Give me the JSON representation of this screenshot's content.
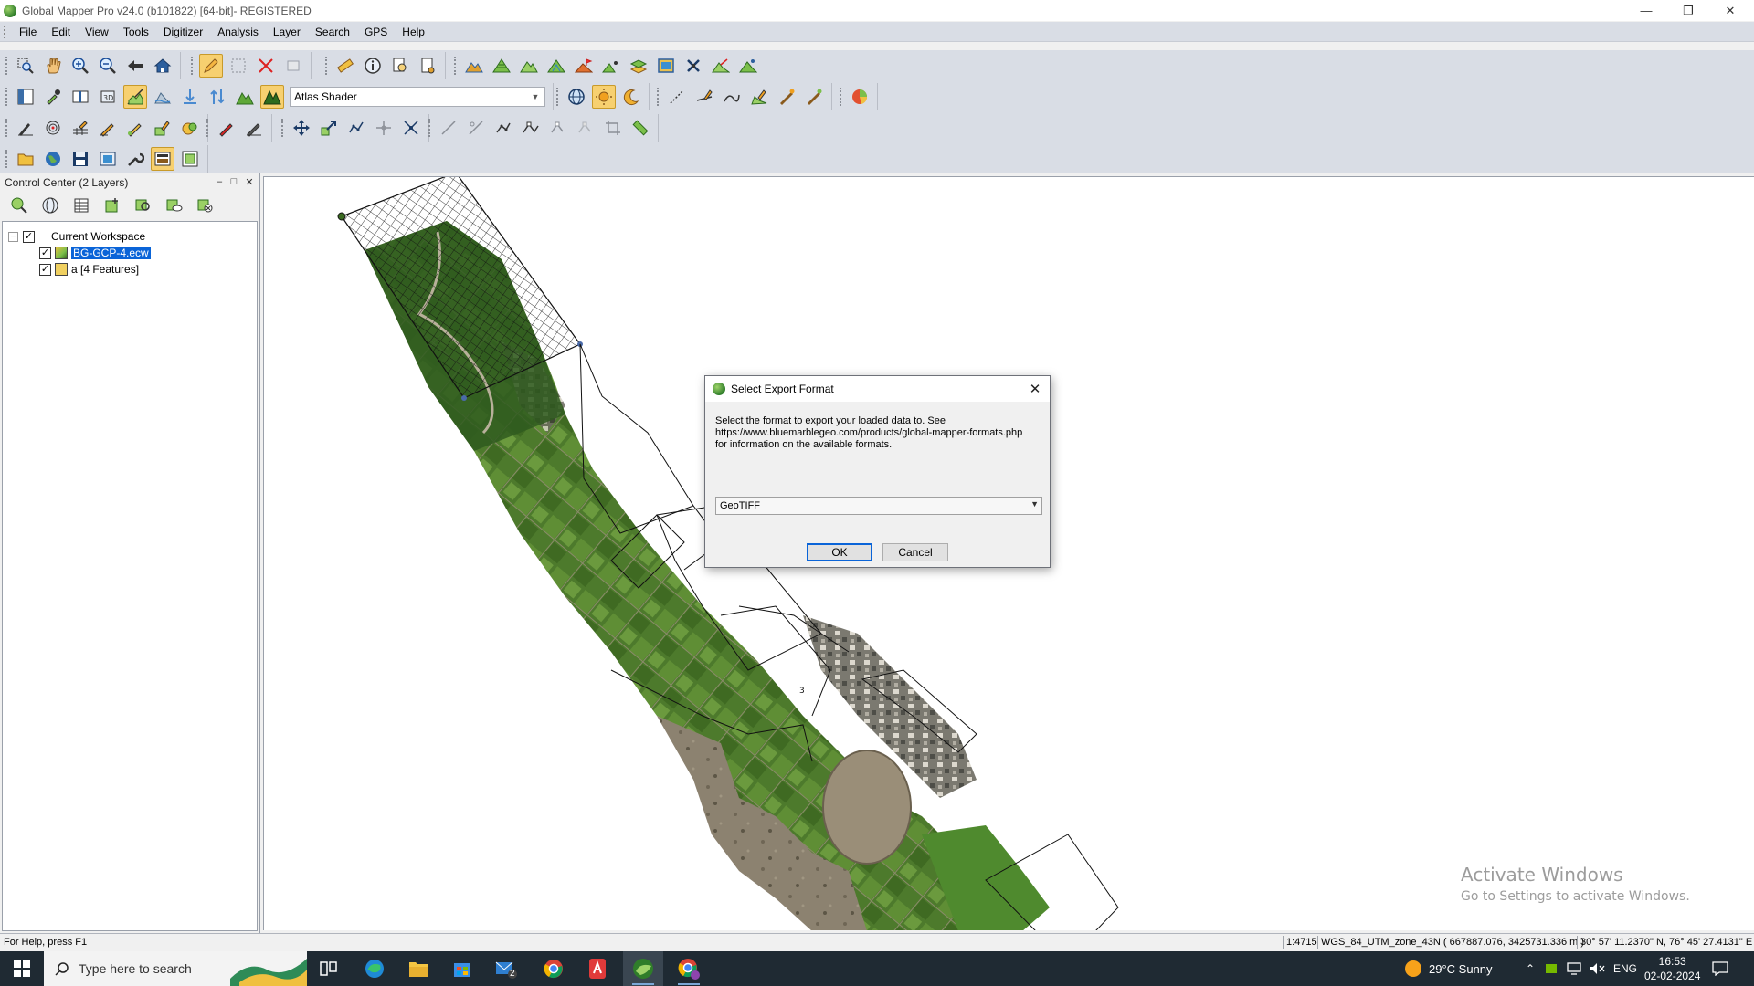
{
  "window": {
    "title": "Global Mapper Pro v24.0 (b101822) [64-bit]- REGISTERED",
    "minimize_glyph": "—",
    "restore_glyph": "❐",
    "close_glyph": "✕"
  },
  "menu": [
    "File",
    "Edit",
    "View",
    "Tools",
    "Digitizer",
    "Analysis",
    "Layer",
    "Search",
    "GPS",
    "Help"
  ],
  "toolbars": {
    "shader_value": "Atlas Shader"
  },
  "control_center": {
    "title": "Control Center (2 Layers)",
    "minimize_glyph": "–",
    "float_glyph": "□",
    "close_glyph": "✕",
    "tree": {
      "expander": "−",
      "workspace": "Current Workspace",
      "layers": [
        "BG-GCP-4.ecw",
        "a [4 Features]"
      ]
    }
  },
  "map": {
    "activate_title": "Activate Windows",
    "activate_sub": "Go to Settings to activate Windows.",
    "feature_label": "3"
  },
  "dialog": {
    "title": "Select Export Format",
    "description_lines": [
      "Select the format to export your loaded data to. See",
      "https://www.bluemarblegeo.com/products/global-mapper-formats.php",
      "for information on the available formats."
    ],
    "selected_format": "GeoTIFF",
    "ok_label": "OK",
    "cancel_label": "Cancel"
  },
  "status": {
    "help": "For Help, press F1",
    "scale": "1:4715",
    "projection": "WGS_84_UTM_zone_43N ( 667887.076, 3425731.336 m )",
    "latlon": "30° 57' 11.2370\" N, 76° 45' 27.4131\" E"
  },
  "taskbar": {
    "search_placeholder": "Type here to search",
    "weather": "29°C  Sunny",
    "language": "ENG",
    "time": "16:53",
    "date": "02-02-2024",
    "mail_badge": "2"
  },
  "colors": {
    "selection": "#0a64d8",
    "toolbar_bg": "#d9dde5",
    "taskbar_bg": "#1f2a33"
  }
}
